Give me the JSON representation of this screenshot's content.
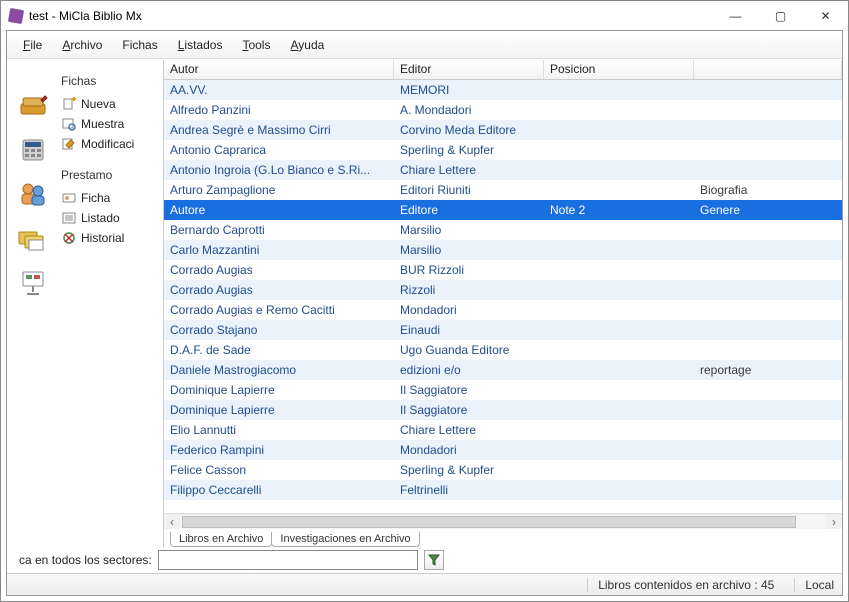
{
  "window": {
    "title": "test - MiCla Biblio Mx"
  },
  "menu": {
    "file": "File",
    "archivo": "Archivo",
    "fichas": "Fichas",
    "listados": "Listados",
    "tools": "Tools",
    "ayuda": "Ayuda"
  },
  "sidebar": {
    "section1": "Fichas",
    "items1": [
      {
        "icon": "new",
        "label": "Nueva"
      },
      {
        "icon": "show",
        "label": "Muestra"
      },
      {
        "icon": "edit",
        "label": "Modificaci"
      }
    ],
    "section2": "Prestamo",
    "items2": [
      {
        "icon": "card",
        "label": "Ficha"
      },
      {
        "icon": "list",
        "label": "Listado"
      },
      {
        "icon": "hist",
        "label": "Historial"
      }
    ]
  },
  "columns": [
    "Autor",
    "Editor",
    "Posicion",
    ""
  ],
  "rows": [
    {
      "autor": "AA.VV.",
      "editor": "MEMORI",
      "pos": "",
      "extra": "",
      "sel": false
    },
    {
      "autor": "Alfredo Panzini",
      "editor": "A. Mondadori",
      "pos": "",
      "extra": "",
      "sel": false
    },
    {
      "autor": "Andrea Segrè e Massimo Cirri",
      "editor": "Corvino Meda Editore",
      "pos": "",
      "extra": "",
      "sel": false
    },
    {
      "autor": "Antonio Caprarica",
      "editor": "Sperling & Kupfer",
      "pos": "",
      "extra": "",
      "sel": false
    },
    {
      "autor": "Antonio Ingroia (G.Lo Bianco e S.Ri...",
      "editor": "Chiare Lettere",
      "pos": "",
      "extra": "",
      "sel": false
    },
    {
      "autor": "Arturo Zampaglione",
      "editor": "Editori Riuniti",
      "pos": "",
      "extra": "Biografia",
      "sel": false
    },
    {
      "autor": "Autore",
      "editor": "Editore",
      "pos": "Note 2",
      "extra": "Genere",
      "sel": true
    },
    {
      "autor": "Bernardo Caprotti",
      "editor": "Marsilio",
      "pos": "",
      "extra": "",
      "sel": false
    },
    {
      "autor": "Carlo Mazzantini",
      "editor": "Marsilio",
      "pos": "",
      "extra": "",
      "sel": false
    },
    {
      "autor": "Corrado Augias",
      "editor": "BUR Rizzoli",
      "pos": "",
      "extra": "",
      "sel": false
    },
    {
      "autor": "Corrado Augias",
      "editor": "Rizzoli",
      "pos": "",
      "extra": "",
      "sel": false
    },
    {
      "autor": "Corrado Augias e Remo Cacitti",
      "editor": "Mondadori",
      "pos": "",
      "extra": "",
      "sel": false
    },
    {
      "autor": "Corrado Stajano",
      "editor": "Einaudi",
      "pos": "",
      "extra": "",
      "sel": false
    },
    {
      "autor": "D.A.F. de Sade",
      "editor": "Ugo Guanda Editore",
      "pos": "",
      "extra": "",
      "sel": false
    },
    {
      "autor": "Daniele Mastrogiacomo",
      "editor": "edizioni e/o",
      "pos": "",
      "extra": "reportage",
      "sel": false
    },
    {
      "autor": "Dominique Lapierre",
      "editor": "Il Saggiatore",
      "pos": "",
      "extra": "",
      "sel": false
    },
    {
      "autor": "Dominique Lapierre",
      "editor": "Il Saggiatore",
      "pos": "",
      "extra": "",
      "sel": false
    },
    {
      "autor": "Elio Lannutti",
      "editor": "Chiare Lettere",
      "pos": "",
      "extra": "",
      "sel": false
    },
    {
      "autor": "Federico Rampini",
      "editor": "Mondadori",
      "pos": "",
      "extra": "",
      "sel": false
    },
    {
      "autor": "Felice Casson",
      "editor": "Sperling & Kupfer",
      "pos": "",
      "extra": "",
      "sel": false
    },
    {
      "autor": "Filippo Ceccarelli",
      "editor": "Feltrinelli",
      "pos": "",
      "extra": "",
      "sel": false
    }
  ],
  "tabs": [
    "Libros en Archivo",
    "Investigaciones en Archivo"
  ],
  "search": {
    "label": "ca en todos los sectores:",
    "placeholder": ""
  },
  "status": {
    "count": "Libros contenidos en archivo : 45",
    "mode": "Local"
  }
}
